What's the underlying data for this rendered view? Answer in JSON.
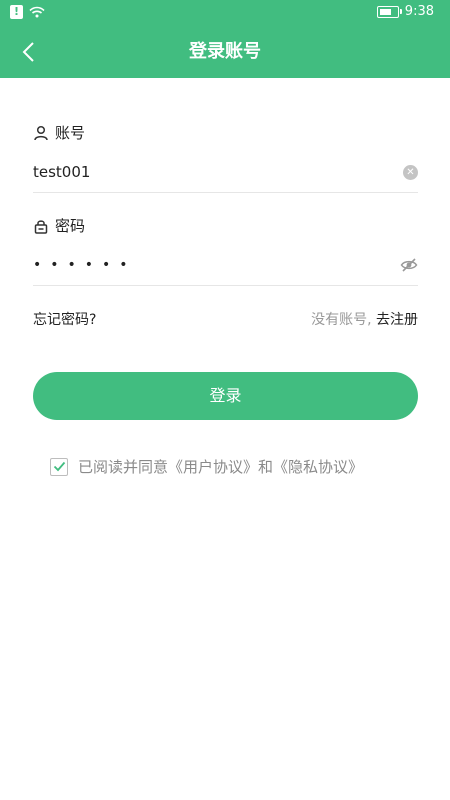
{
  "status_bar": {
    "alert_icon": "alert-icon",
    "wifi_icon": "wifi-icon",
    "battery_icon": "battery-icon",
    "time": "9:38"
  },
  "header": {
    "title": "登录账号",
    "back_icon": "chevron-left-icon"
  },
  "account": {
    "label": "账号",
    "icon": "user-icon",
    "value": "test001",
    "clear_icon": "close-icon"
  },
  "password": {
    "label": "密码",
    "icon": "lock-icon",
    "masked_value": "••••••",
    "eye_icon": "eye-off-icon"
  },
  "links": {
    "forgot": "忘记密码?",
    "no_account": "没有账号,",
    "register": "去注册"
  },
  "login_button": "登录",
  "agreement": {
    "checked": true,
    "prefix": "已阅读并同意",
    "user_agreement": "《用户协议》",
    "connector": "和",
    "privacy_policy": "《隐私协议》"
  },
  "colors": {
    "primary": "#41bd80",
    "text": "#222222",
    "muted": "#8a8a8a",
    "divider": "#e6e6e6"
  }
}
